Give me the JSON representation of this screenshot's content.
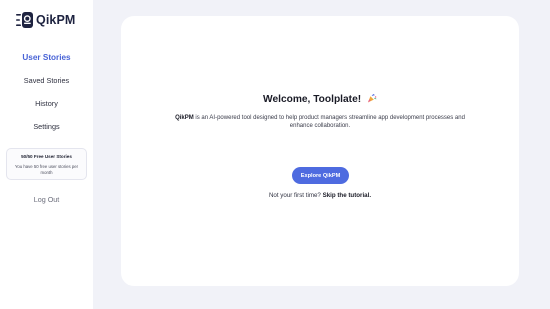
{
  "app": {
    "name": "QikPM",
    "logo_icon": "qikpm-logo-icon"
  },
  "sidebar": {
    "items": [
      {
        "label": "User Stories",
        "active": true
      },
      {
        "label": "Saved Stories",
        "active": false
      },
      {
        "label": "History",
        "active": false
      },
      {
        "label": "Settings",
        "active": false
      }
    ],
    "credits": {
      "title": "50/50 Free User Stories",
      "description": "You have 50 free user stories per month"
    },
    "logout_label": "Log Out"
  },
  "main": {
    "welcome": "Welcome, Toolplate!",
    "welcome_icon": "party-popper-icon",
    "description_brand": "QikPM",
    "description": " is an AI-powered tool designed to help product managers streamline app development processes and enhance collaboration.",
    "explore_button": "Explore QikPM",
    "first_time_prefix": "Not your first time? ",
    "skip_link": "Skip the tutorial."
  },
  "colors": {
    "accent": "#4e6be0",
    "active_nav": "#4863d6",
    "background": "#f1f2f8",
    "logo": "#1e2340"
  }
}
